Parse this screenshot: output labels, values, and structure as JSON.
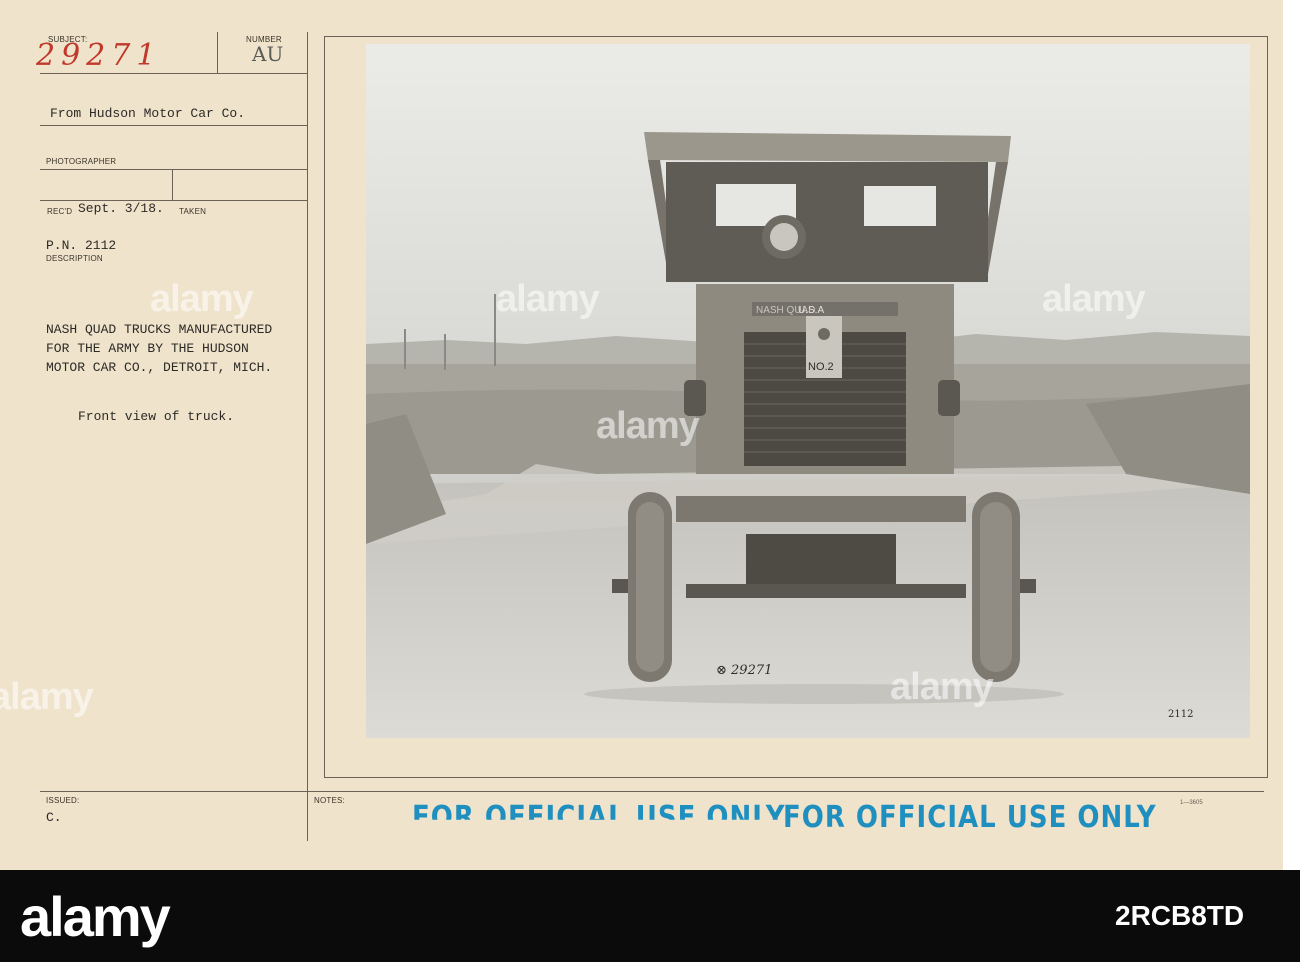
{
  "header": {
    "subject_label": "SUBJECT:",
    "subject_number": "29271",
    "number_label": "NUMBER",
    "number_value": "AU"
  },
  "record": {
    "from_text": "From Hudson Motor Car Co.",
    "photographer_label": "PHOTOGRAPHER",
    "recd_label": "REC'D",
    "recd_value": "Sept. 3/18.",
    "taken_label": "TAKEN",
    "pn": "P.N. 2112",
    "description_label": "DESCRIPTION",
    "description_lines": [
      "NASH QUAD TRUCKS MANUFACTURED",
      "FOR THE ARMY BY THE HUDSON",
      "MOTOR CAR CO., DETROIT, MICH."
    ],
    "caption": "Front view of truck.",
    "issued_label": "ISSUED:",
    "issued_value": "C.",
    "notes_label": "NOTES:",
    "form_number": "1—3605"
  },
  "photo": {
    "negative_mark": "⊗ 29271",
    "plate_number": "2112",
    "truck_plate_top": "U.S.A",
    "truck_plate_name": "NASH QUAD",
    "truck_badge": "NO.2"
  },
  "stamps": {
    "stamp_left": "FOR OFFICIAL USE ONLY",
    "stamp_right": "FOR OFFICIAL USE ONLY"
  },
  "watermark": {
    "text": "alamy",
    "footer_logo": "alamy",
    "footer_id": "2RCB8TD"
  }
}
